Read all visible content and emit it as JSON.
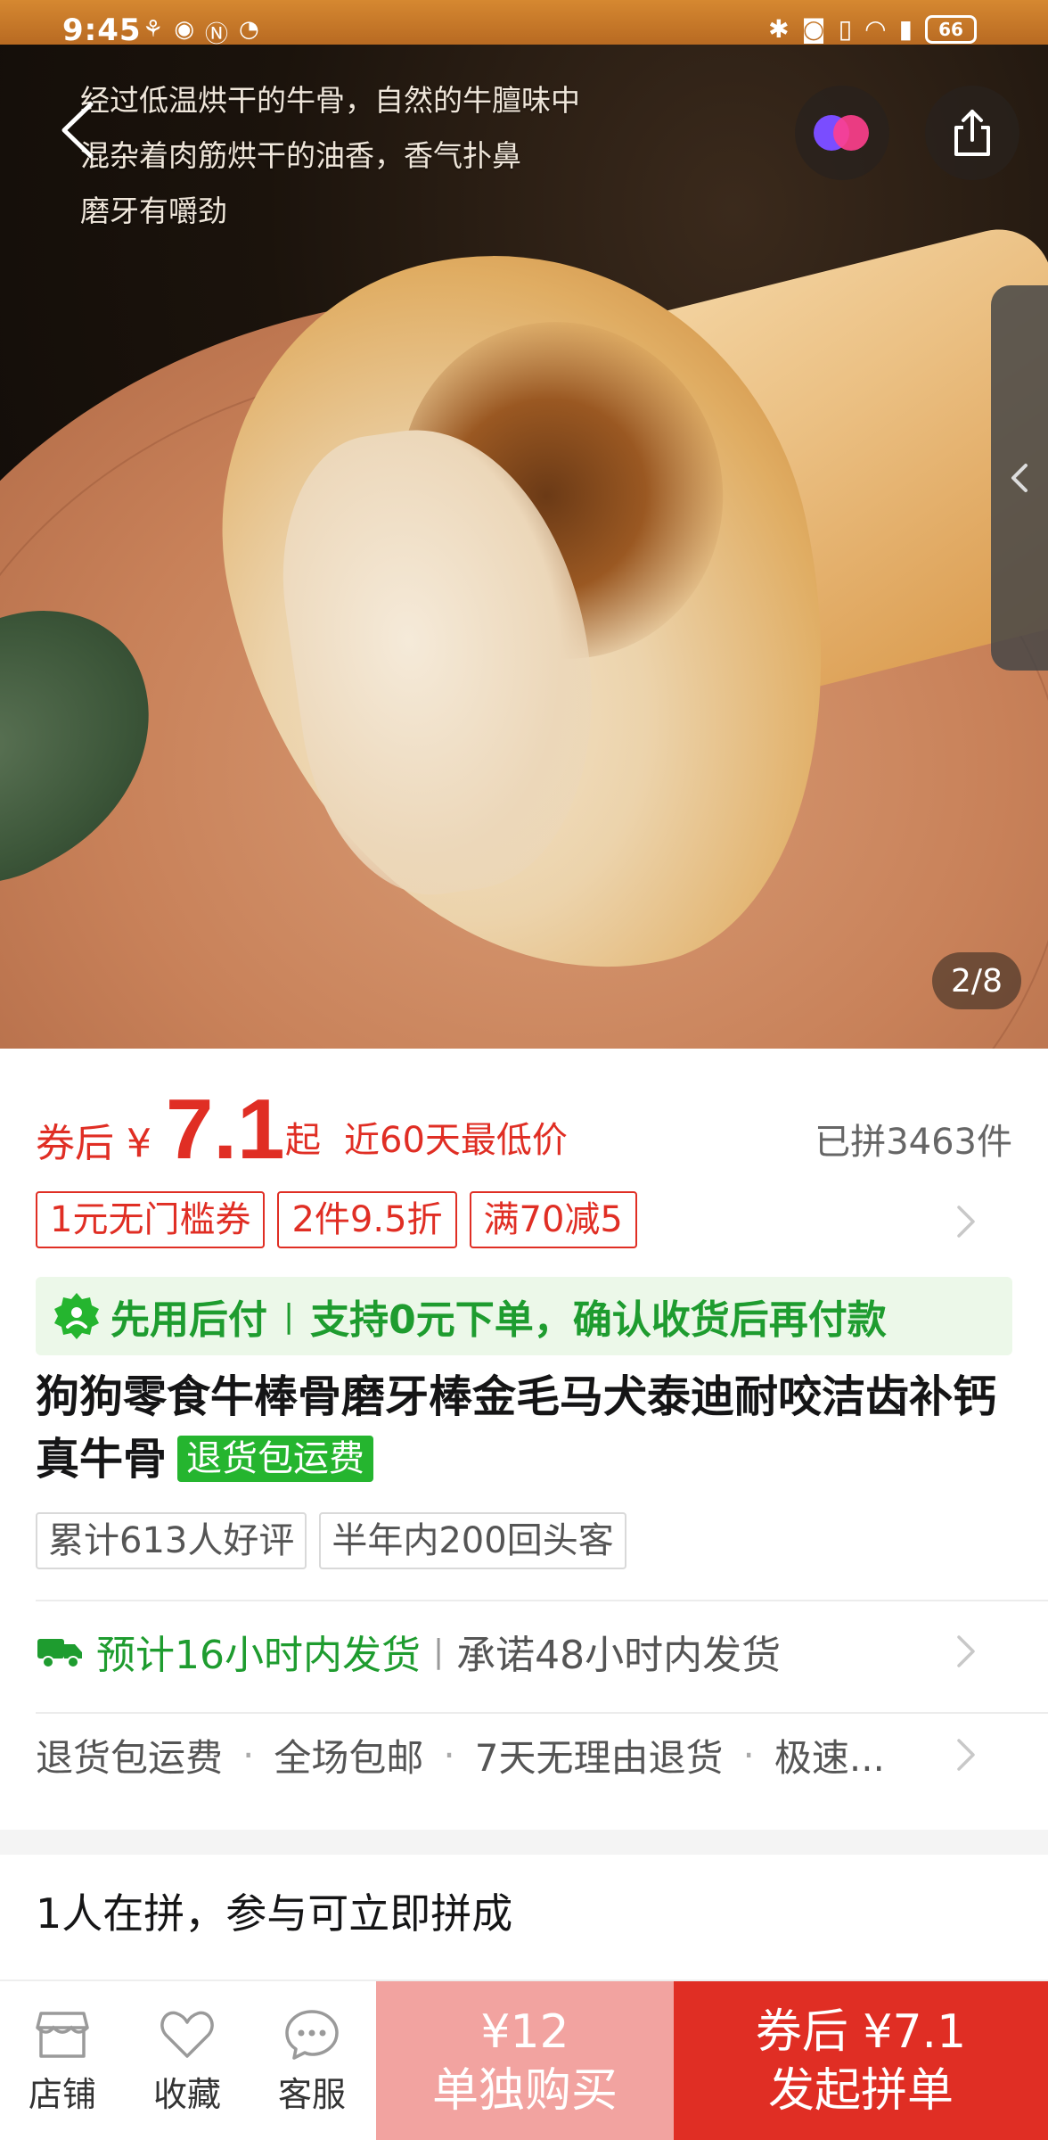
{
  "status_bar": {
    "time": "9:45",
    "battery": "66"
  },
  "hero": {
    "caption_lines": [
      "经过低温烘干的牛骨，自然的牛膻味中",
      "混杂着肉筋烘干的油香，香气扑鼻",
      "磨牙有嚼劲"
    ],
    "page_indicator": "2/8"
  },
  "price": {
    "prefix": "券后 ¥",
    "value": "7.1",
    "suffix": "起",
    "note": "近60天最低价",
    "sold": "已拼3463件"
  },
  "coupons": [
    "1元无门槛券",
    "2件9.5折",
    "满70减5"
  ],
  "pay_later": {
    "label": "先用后付",
    "text": "支持0元下单，确认收货后再付款"
  },
  "product": {
    "title": "狗狗零食牛棒骨磨牙棒金毛马犬泰迪耐咬洁齿补钙真牛骨",
    "badge": "退货包运费"
  },
  "review_tags": [
    "累计613人好评",
    "半年内200回头客"
  ],
  "shipping": {
    "estimate": "预计16小时内发货",
    "promise": "承诺48小时内发货"
  },
  "services": [
    "退货包运费",
    "全场包邮",
    "7天无理由退货",
    "极速..."
  ],
  "group": {
    "title": "1人在拼，参与可立即拼成"
  },
  "bottom_bar": {
    "store": "店铺",
    "favorite": "收藏",
    "service": "客服",
    "single_price": "¥12",
    "single_label": "单独购买",
    "group_price": "券后 ¥7.1",
    "group_label": "发起拼单"
  },
  "colors": {
    "accent_red": "#e02e24",
    "green": "#1e9c2f",
    "light_red": "#f2a3a0"
  },
  "icons": [
    "back-arrow-icon",
    "ai-assistant-icon",
    "share-icon",
    "collapse-chevron-icon",
    "chevron-right-icon",
    "pay-later-badge-icon",
    "truck-icon",
    "store-icon",
    "heart-icon",
    "chat-icon"
  ]
}
